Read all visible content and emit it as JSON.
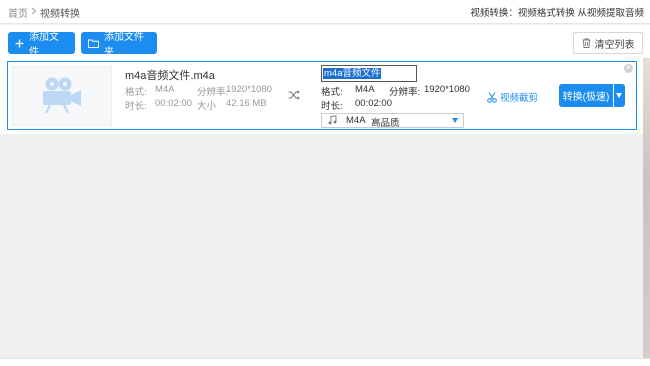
{
  "breadcrumb": {
    "home": "首页",
    "current": "视频转换"
  },
  "topnote": "视频转换：视频格式转换 从视频提取音频",
  "toolbar": {
    "add_file": "添加文件",
    "add_folder": "添加文件夹",
    "clear_list": "清空列表"
  },
  "file": {
    "name": "m4a音频文件.m4a",
    "format_label": "格式:",
    "format": "M4A",
    "resolution_label": "分辨率:",
    "resolution": "1920*1080",
    "duration_label": "时长:",
    "duration": "00:02:00",
    "size_label": "大小",
    "size": "42.16 MB"
  },
  "output": {
    "name": "m4a音频文件",
    "format_label": "格式:",
    "format": "M4A",
    "resolution_label": "分辨率:",
    "resolution": "1920*1080",
    "duration_label": "时长:",
    "duration": "00:02:00",
    "select_format": "M4A",
    "select_quality": "高品质"
  },
  "actions": {
    "cut": "视频截剪",
    "convert": "转换(极速)"
  },
  "colors": {
    "accent": "#1b8cf0"
  },
  "icons": [
    "chevron-right-icon",
    "plus-icon",
    "folder-icon",
    "trash-icon",
    "film-camera-icon",
    "shuffle-icon",
    "music-note-icon",
    "scissors-icon",
    "close-icon",
    "dropdown-arrow-icon"
  ]
}
